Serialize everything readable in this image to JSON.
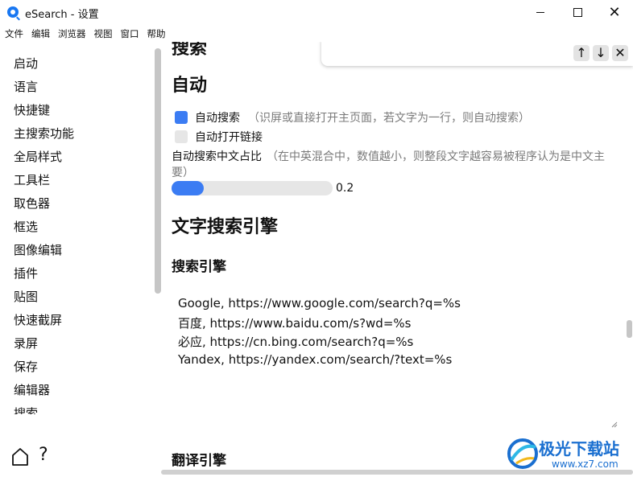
{
  "window": {
    "title": "eSearch - 设置",
    "close_glyph": "✕"
  },
  "menubar": [
    "文件",
    "编辑",
    "浏览器",
    "视图",
    "窗口",
    "帮助"
  ],
  "sidebar": {
    "items": [
      "启动",
      "语言",
      "快捷键",
      "主搜索功能",
      "全局样式",
      "工具栏",
      "取色器",
      "框选",
      "图像编辑",
      "插件",
      "贴图",
      "快速截屏",
      "录屏",
      "保存",
      "编辑器",
      "搜索"
    ],
    "help_glyph": "?"
  },
  "find_bar": {
    "up_glyph": "↑",
    "down_glyph": "↓",
    "close_glyph": "✕"
  },
  "main": {
    "partial_heading": "搜索",
    "auto": {
      "heading": "自动",
      "auto_search": {
        "label": "自动搜索",
        "hint": "（识屏或直接打开主页面，若文字为一行，则自动搜索）",
        "checked": true
      },
      "auto_open_link": {
        "label": "自动打开链接",
        "checked": false
      },
      "ratio": {
        "label": "自动搜索中文占比",
        "hint": "（在中英混合中，数值越小，则整段文字越容易被程序认为是中文主要）",
        "value": "0.2",
        "fraction": 0.2
      }
    },
    "text_search": {
      "heading": "文字搜索引擎",
      "engines_heading": "搜索引擎",
      "engines": [
        "Google, https://www.google.com/search?q=%s",
        "百度, https://www.baidu.com/s?wd=%s",
        "必应, https://cn.bing.com/search?q=%s",
        "Yandex, https://yandex.com/search/?text=%s"
      ],
      "translate_heading": "翻译引擎"
    }
  },
  "watermark": {
    "title": "极光下载站",
    "url": "www.xz7.com"
  },
  "colors": {
    "accent": "#3b7cf3",
    "toggle_off": "#e6e6e6",
    "hint_text": "#7a7a7a",
    "watermark": "#1a6fd0"
  }
}
